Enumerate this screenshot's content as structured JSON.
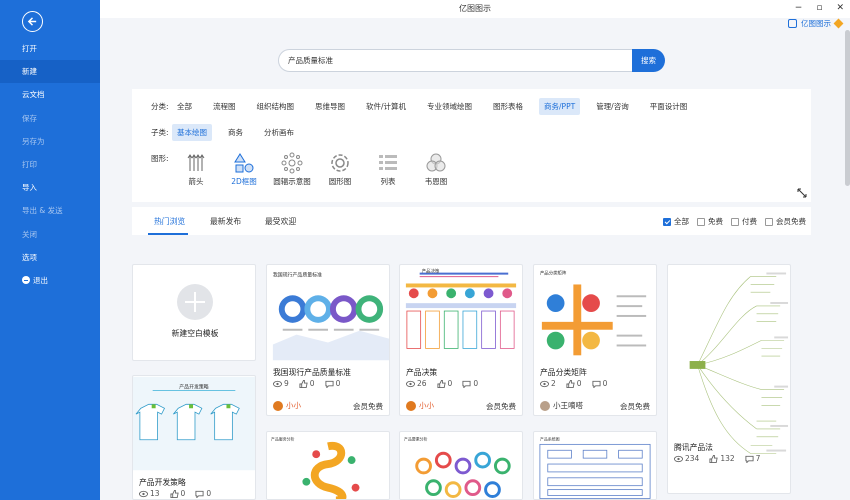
{
  "app": {
    "title": "亿图图示",
    "user_label": "亿图图示"
  },
  "sidebar": {
    "items": [
      {
        "label": "打开"
      },
      {
        "label": "新建"
      },
      {
        "label": "云文档"
      },
      {
        "label": "保存"
      },
      {
        "label": "另存为"
      },
      {
        "label": "打印"
      },
      {
        "label": "导入"
      },
      {
        "label": "导出 & 发送"
      },
      {
        "label": "关闭"
      },
      {
        "label": "选项"
      },
      {
        "label": "退出"
      }
    ]
  },
  "search": {
    "value": "产品质量标准",
    "button": "搜索"
  },
  "filters": {
    "category_label": "分类:",
    "categories": [
      "全部",
      "流程图",
      "组织结构图",
      "思维导图",
      "软件/计算机",
      "专业领域绘图",
      "图形表格",
      "商务/PPT",
      "管理/咨询",
      "平面设计图"
    ],
    "subcategory_label": "子类:",
    "subcategories": [
      "基本绘图",
      "商务",
      "分析画布"
    ],
    "shape_label": "图形:",
    "shapes": [
      "箭头",
      "2D框图",
      "圆辐示意图",
      "圆形图",
      "列表",
      "韦恩图"
    ]
  },
  "tabs": {
    "items": [
      "热门浏览",
      "最新发布",
      "最受欢迎"
    ]
  },
  "checks": {
    "items": [
      "全部",
      "免费",
      "付费",
      "会员免费"
    ]
  },
  "cards": {
    "new_blank": "新建空白模板",
    "c1": {
      "title": "我国现行产品质量标准",
      "views": "9",
      "likes": "0",
      "comments": "0",
      "author": "小小",
      "badge": "会员免费",
      "heading": "我国现行产品质量标准"
    },
    "c2": {
      "title": "产品决策",
      "views": "26",
      "likes": "0",
      "comments": "0",
      "author": "小小",
      "badge": "会员免费",
      "heading": "产品决策"
    },
    "c3": {
      "title": "产品分类矩阵",
      "views": "2",
      "likes": "0",
      "comments": "0",
      "author": "小王嘀嗒",
      "badge": "会员免费",
      "heading": "产品分类矩阵"
    },
    "c4": {
      "title": "腾讯产品法",
      "views": "234",
      "likes": "132",
      "comments": "7"
    },
    "c5": {
      "title": "产品开发策略",
      "views": "13",
      "likes": "0",
      "comments": "0",
      "heading": "产品开发策略"
    },
    "c6": {
      "heading": "产品服务分析"
    },
    "c7": {
      "heading": "产品要素分析"
    },
    "c8": {
      "heading": "产品系统图"
    }
  },
  "colors": {
    "accent": "#1e6fd9",
    "sidebar": "#1e6fd9"
  }
}
